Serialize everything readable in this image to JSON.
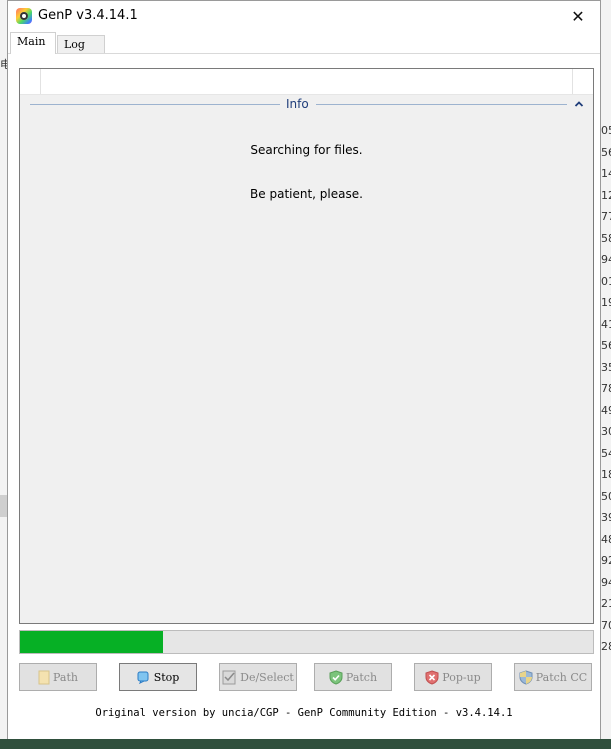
{
  "window": {
    "title": "GenP v3.4.14.1",
    "close_glyph": "✕"
  },
  "tabs": [
    {
      "label": "Main",
      "active": true
    },
    {
      "label": "Log",
      "active": false
    }
  ],
  "info_group": {
    "title": "Info",
    "messages": [
      "Searching for files.",
      "Be patient, please."
    ]
  },
  "progress": {
    "value_percent": 25,
    "color": "#06b025"
  },
  "buttons": {
    "path": {
      "label": "Path",
      "icon": "folder-icon",
      "enabled": false
    },
    "stop": {
      "label": "Stop",
      "icon": "stop-icon",
      "enabled": true
    },
    "deselect": {
      "label": "De/Select",
      "icon": "checklist-icon",
      "enabled": false
    },
    "patch": {
      "label": "Patch",
      "icon": "shield-check-icon",
      "enabled": false
    },
    "popup": {
      "label": "Pop-up",
      "icon": "shield-x-icon",
      "enabled": false
    },
    "patch_cc": {
      "label": "Patch CC",
      "icon": "uac-shield-icon",
      "enabled": false
    }
  },
  "footer": {
    "text": "Original version by uncia/CGP - GenP Community Edition - v3.4.14.1"
  },
  "background": {
    "left_fragment": "电",
    "right_numbers": [
      "05",
      "56",
      "14",
      "12",
      "77",
      "58",
      "94",
      "01",
      "19",
      "41",
      "56",
      "35",
      "78",
      "49",
      "30",
      "54",
      "18",
      "50",
      "39",
      "48",
      "92",
      "94",
      "21",
      "70",
      "28"
    ]
  }
}
